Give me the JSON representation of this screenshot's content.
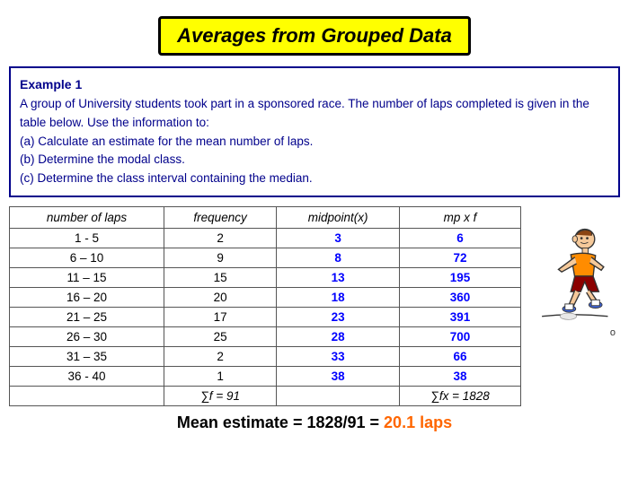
{
  "title": "Averages from Grouped Data",
  "example": {
    "label": "Example 1",
    "description": "A group of University students took part in a sponsored race. The number of laps completed is given in the table below. Use the information to:",
    "parts": [
      "(a) Calculate an estimate for the mean number of laps.",
      "(b) Determine the modal class.",
      "(c) Determine the class interval containing the median."
    ]
  },
  "table": {
    "headers": [
      "number of laps",
      "frequency",
      "midpoint(x)",
      "mp x f"
    ],
    "rows": [
      {
        "laps": "1 - 5",
        "freq": "2",
        "mid": "3",
        "mpf": "6"
      },
      {
        "laps": "6 – 10",
        "freq": "9",
        "mid": "8",
        "mpf": "72"
      },
      {
        "laps": "11 – 15",
        "freq": "15",
        "mid": "13",
        "mpf": "195"
      },
      {
        "laps": "16 – 20",
        "freq": "20",
        "mid": "18",
        "mpf": "360"
      },
      {
        "laps": "21 – 25",
        "freq": "17",
        "mid": "23",
        "mpf": "391"
      },
      {
        "laps": "26 – 30",
        "freq": "25",
        "mid": "28",
        "mpf": "700"
      },
      {
        "laps": "31 – 35",
        "freq": "2",
        "mid": "33",
        "mpf": "66"
      },
      {
        "laps": "36 - 40",
        "freq": "1",
        "mid": "38",
        "mpf": "38"
      }
    ],
    "sum_freq": "∑f = 91",
    "sum_mpf": "∑fx = 1828"
  },
  "mean_line": {
    "prefix": "Mean estimate = 1828/91 = ",
    "value": "20.1 laps"
  }
}
